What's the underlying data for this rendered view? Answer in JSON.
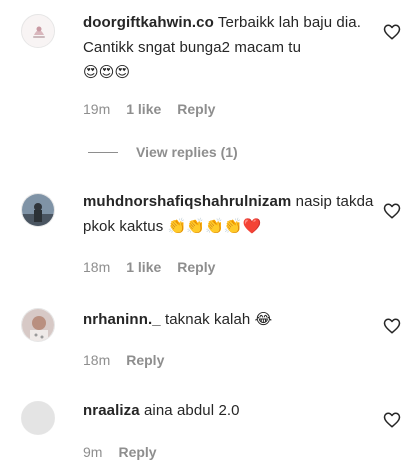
{
  "comments": [
    {
      "username": "doorgiftkahwin.co",
      "text": "Terbaikk lah baju dia. Cantikk sngat bunga2 macam tu",
      "emojis": "😍😍😍",
      "time": "19m",
      "likes": "1 like",
      "reply": "Reply",
      "view_replies": "View replies (1)"
    },
    {
      "username": "muhdnorshafiqshahrulnizam",
      "text": "nasip takda pkok kaktus",
      "emojis": "👏👏👏👏❤️",
      "time": "18m",
      "likes": "1 like",
      "reply": "Reply"
    },
    {
      "username": "nrhaninn._",
      "text": "taknak kalah",
      "emojis": "😂",
      "time": "18m",
      "reply": "Reply"
    },
    {
      "username": "nraaliza",
      "text": "aina abdul 2.0",
      "time": "9m",
      "reply": "Reply"
    }
  ],
  "colors": {
    "text": "#262626",
    "meta": "#8e8e8e",
    "heart_icon": "#262626"
  }
}
